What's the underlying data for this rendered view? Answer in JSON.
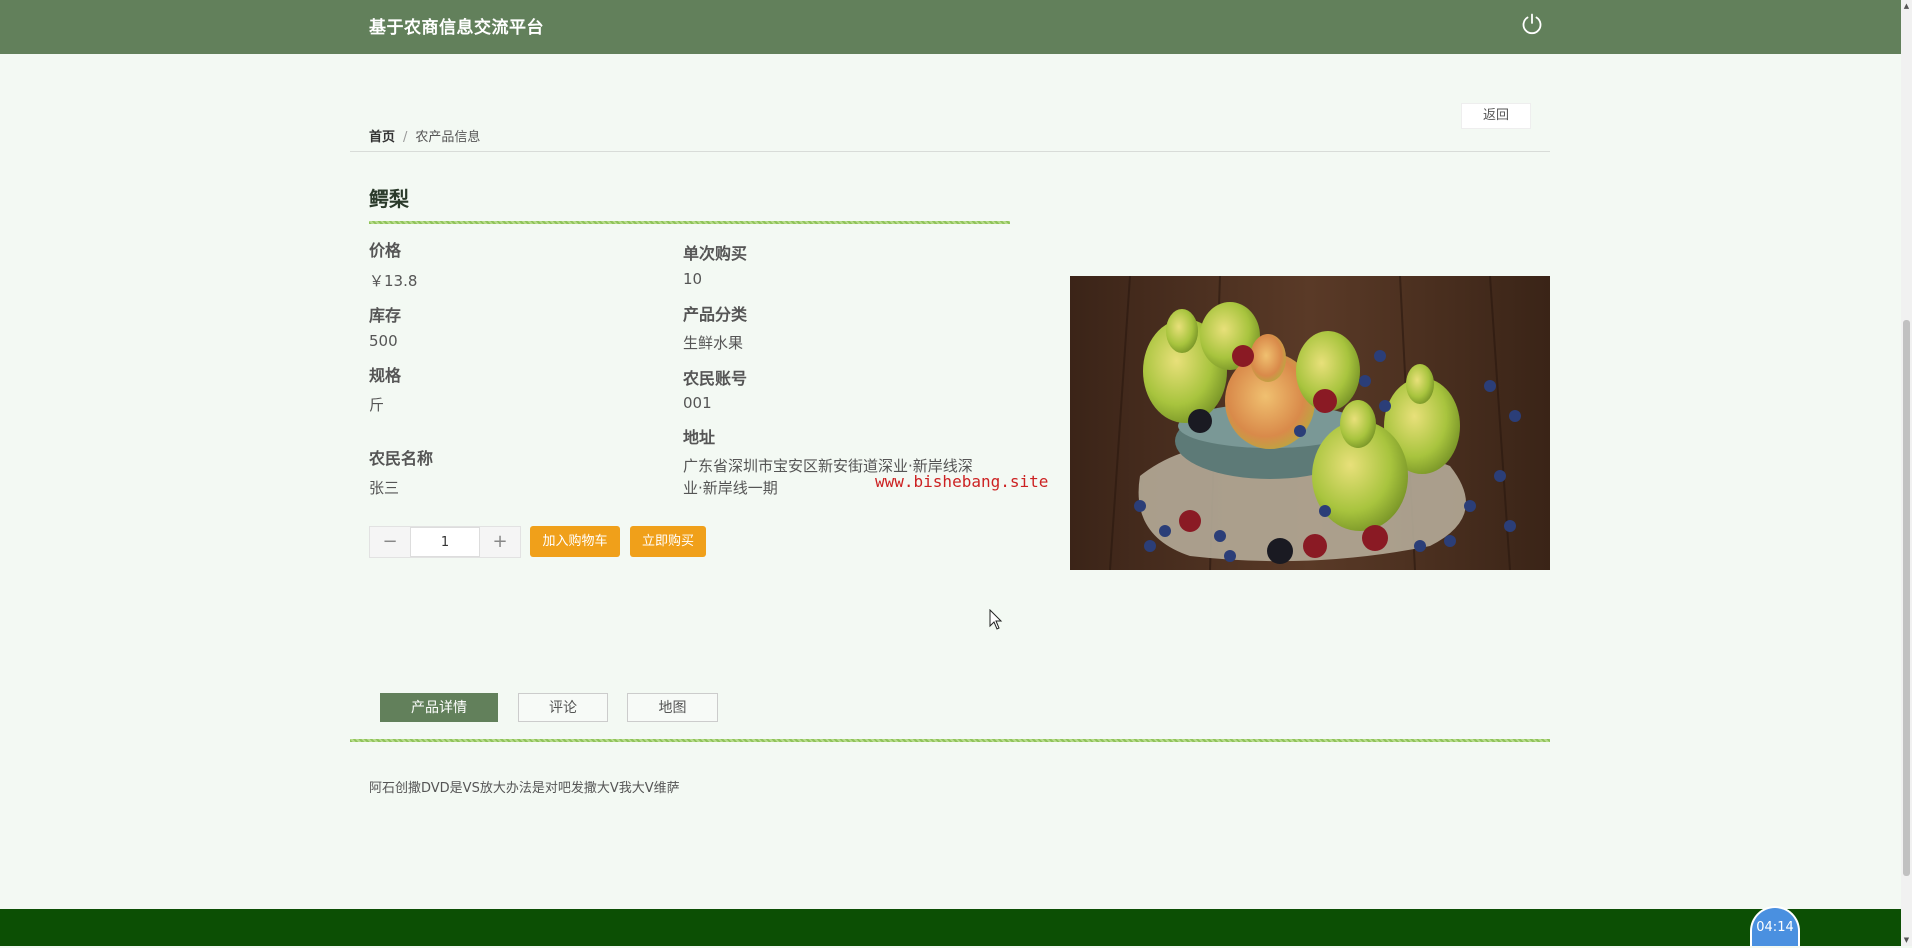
{
  "header": {
    "title": "基于农商信息交流平台",
    "logout_icon": "power-icon"
  },
  "nav": {
    "back_label": "返回"
  },
  "breadcrumb": {
    "home": "首页",
    "separator": "/",
    "current": "农产品信息"
  },
  "product": {
    "name": "鳄梨",
    "fields": {
      "price_label": "价格",
      "price_value": "￥13.8",
      "stock_label": "库存",
      "stock_value": "500",
      "spec_label": "规格",
      "spec_value": "斤",
      "farmer_name_label": "农民名称",
      "farmer_name_value": "张三",
      "single_purchase_label": "单次购买",
      "single_purchase_value": "10",
      "category_label": "产品分类",
      "category_value": "生鲜水果",
      "farmer_account_label": "农民账号",
      "farmer_account_value": "001",
      "address_label": "地址",
      "address_value": "广东省深圳市宝安区新安街道深业·新岸线深业·新岸线一期"
    },
    "image_icon": "pears-photo"
  },
  "watermark": "www.bishebang.site",
  "purchase": {
    "quantity": "1",
    "minus_label": "−",
    "plus_label": "+",
    "add_to_cart_label": "加入购物车",
    "buy_now_label": "立即购买"
  },
  "tabs": [
    {
      "label": "产品详情",
      "active": true
    },
    {
      "label": "评论",
      "active": false
    },
    {
      "label": "地图",
      "active": false
    }
  ],
  "detail": {
    "text": "阿石创撒DVD是VS放大办法是对吧发撒大V我大V维萨"
  },
  "timer": {
    "label": "04:14"
  },
  "colors": {
    "header_bg": "#62805b",
    "page_bg": "#f3f9f3",
    "accent_orange": "#f0a01a",
    "footer_bg": "#0c4f04",
    "tab_active_bg": "#62805b"
  }
}
